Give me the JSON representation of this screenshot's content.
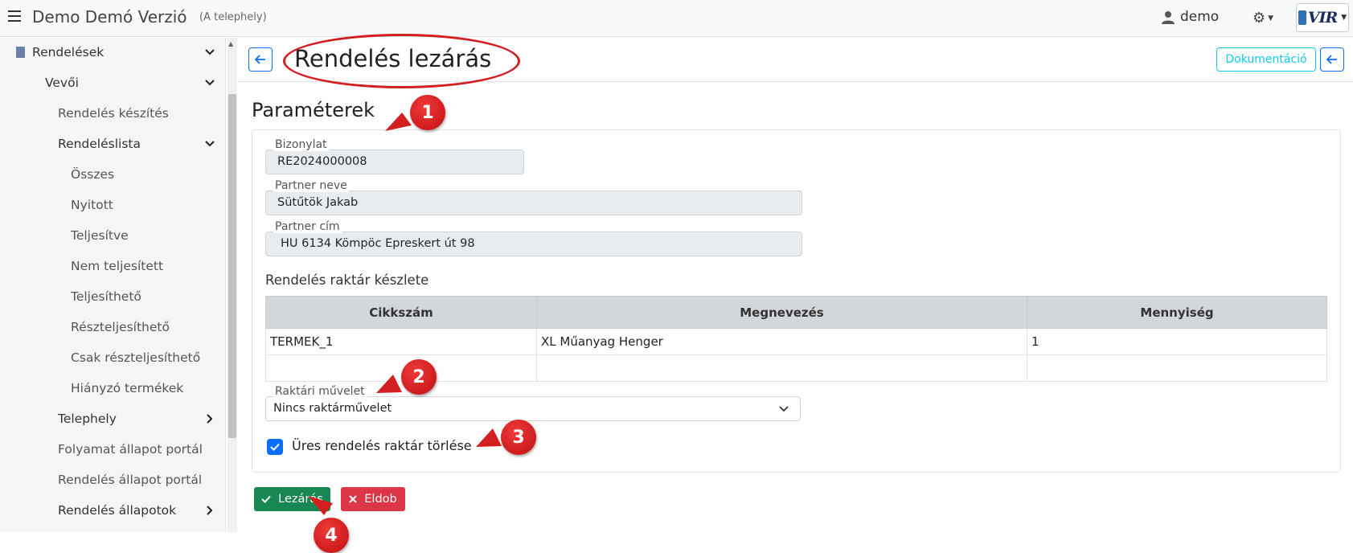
{
  "topbar": {
    "app_title": "Demo Demó Verzió",
    "app_subtitle": "(A telephely)",
    "user_name": "demo",
    "logo_text": "VIR"
  },
  "sidebar": {
    "items": [
      {
        "label": "Rendelések",
        "expand": "down"
      },
      {
        "label": "Vevői",
        "expand": "down"
      },
      {
        "label": "Rendelés készítés",
        "expand": ""
      },
      {
        "label": "Rendeléslista",
        "expand": "down"
      },
      {
        "label": "Összes",
        "expand": ""
      },
      {
        "label": "Nyitott",
        "expand": ""
      },
      {
        "label": "Teljesítve",
        "expand": ""
      },
      {
        "label": "Nem teljesített",
        "expand": ""
      },
      {
        "label": "Teljesíthető",
        "expand": ""
      },
      {
        "label": "Részteljesíthető",
        "expand": ""
      },
      {
        "label": "Csak részteljesíthető",
        "expand": ""
      },
      {
        "label": "Hiányzó termékek",
        "expand": ""
      },
      {
        "label": "Telephely",
        "expand": "right"
      },
      {
        "label": "Folyamat állapot portál",
        "expand": ""
      },
      {
        "label": "Rendelés állapot portál",
        "expand": ""
      },
      {
        "label": "Rendelés állapotok",
        "expand": "right"
      }
    ]
  },
  "header": {
    "title": "Rendelés lezárás",
    "doc_button": "Dokumentáció"
  },
  "params": {
    "section_title": "Paraméterek",
    "bizonylat_label": "Bizonylat",
    "bizonylat_value": "RE2024000008",
    "partner_name_label": "Partner neve",
    "partner_name_value": "Sütűtök Jakab",
    "partner_addr_label": "Partner cím",
    "partner_addr_value": "HU 6134 Kömpöc Epreskert út 98",
    "stock_title": "Rendelés raktár készlete",
    "table": {
      "headers": [
        "Cikkszám",
        "Megnevezés",
        "Mennyiség"
      ],
      "rows": [
        [
          "TERMEK_1",
          "XL Műanyag Henger",
          "1"
        ],
        [
          "",
          "",
          ""
        ]
      ]
    },
    "op_label": "Raktári művelet",
    "op_value": "Nincs raktárművelet",
    "checkbox_label": "Üres rendelés raktár törlése",
    "checkbox_checked": true
  },
  "actions": {
    "ok_label": "Lezárás",
    "cancel_label": "Eldob"
  },
  "annotations": [
    "1",
    "2",
    "3",
    "4"
  ],
  "colors": {
    "primary": "#0d6efd",
    "success": "#198754",
    "danger": "#dc3545",
    "info": "#0dcaf0",
    "annotation": "#d21f1f"
  }
}
